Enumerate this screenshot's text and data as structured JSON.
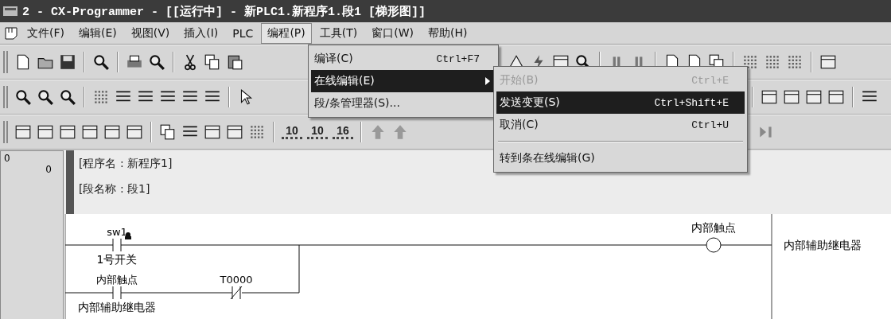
{
  "window": {
    "title": "2 - CX-Programmer - [[运行中] - 新PLC1.新程序1.段1 [梯形图]]"
  },
  "menu_bar": [
    {
      "label": "文件(F)",
      "selected": false
    },
    {
      "label": "编辑(E)",
      "selected": false
    },
    {
      "label": "视图(V)",
      "selected": false
    },
    {
      "label": "插入(I)",
      "selected": false
    },
    {
      "label": "PLC",
      "selected": false
    },
    {
      "label": "编程(P)",
      "selected": true
    },
    {
      "label": "工具(T)",
      "selected": false
    },
    {
      "label": "窗口(W)",
      "selected": false
    },
    {
      "label": "帮助(H)",
      "selected": false
    }
  ],
  "toolbar_number_buttons": [
    "10",
    "10",
    "16"
  ],
  "program_menu": [
    {
      "label": "编译(C)",
      "shortcut": "Ctrl+F7",
      "selected": false,
      "submenu": false
    },
    {
      "label": "在线编辑(E)",
      "selected": true,
      "submenu": true
    },
    {
      "label": "段/条管理器(S)...",
      "selected": false,
      "submenu": false
    }
  ],
  "online_edit_submenu": [
    {
      "kind": "item",
      "label": "开始(B)",
      "shortcut": "Ctrl+E",
      "disabled": true,
      "selected": false
    },
    {
      "kind": "item",
      "label": "发送变更(S)",
      "shortcut": "Ctrl+Shift+E",
      "disabled": false,
      "selected": true
    },
    {
      "kind": "item",
      "label": "取消(C)",
      "shortcut": "Ctrl+U",
      "disabled": false,
      "selected": false
    },
    {
      "kind": "separator"
    },
    {
      "kind": "item",
      "label": "转到条在线编辑(G)",
      "disabled": false,
      "selected": false
    }
  ],
  "ladder": {
    "rung_number": "0",
    "step": "0",
    "program_name": "[程序名 : 新程序1]",
    "section_name": "[段名称 : 段1]",
    "main_contact": {
      "kind": "no",
      "symbol": "sw1",
      "comment": "1号开关"
    },
    "coil": {
      "symbol": "内部触点",
      "comment": "内部辅助继电器"
    },
    "branch": [
      {
        "kind": "no",
        "symbol": "内部触点",
        "comment": "内部辅助继电器"
      },
      {
        "kind": "nc",
        "symbol": "T0000"
      }
    ]
  }
}
